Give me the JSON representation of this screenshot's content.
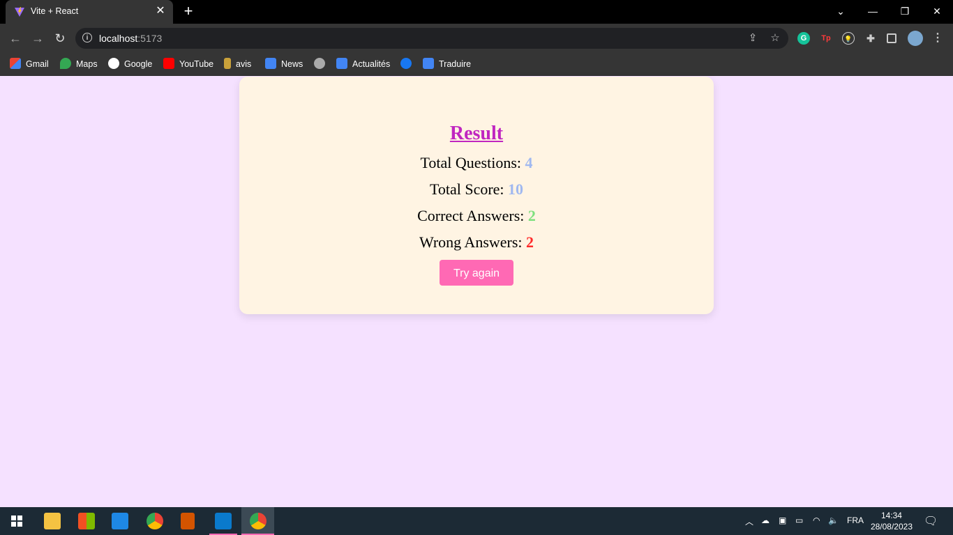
{
  "browser": {
    "tab_title": "Vite + React",
    "url_host": "localhost",
    "url_port": ":5173",
    "bookmarks": [
      "Gmail",
      "Maps",
      "Google",
      "YouTube",
      "avis",
      "News",
      "Actualités",
      "Traduire"
    ]
  },
  "result": {
    "heading": "Result",
    "total_questions_label": "Total Questions:",
    "total_questions_value": "4",
    "total_score_label": "Total Score:",
    "total_score_value": "10",
    "correct_label": "Correct Answers:",
    "correct_value": "2",
    "wrong_label": "Wrong Answers:",
    "wrong_value": "2",
    "button_label": "Try again"
  },
  "colors": {
    "page_bg": "#f5e1ff",
    "card_bg": "#fff4e3",
    "heading": "#c026c0",
    "questions_value": "#a0b8f0",
    "score_value": "#a0b8f0",
    "correct_value": "#7de07d",
    "wrong_value": "#ff2a2a",
    "button": "#ff69b4"
  },
  "taskbar": {
    "language": "FRA",
    "time": "14:34",
    "date": "28/08/2023"
  }
}
